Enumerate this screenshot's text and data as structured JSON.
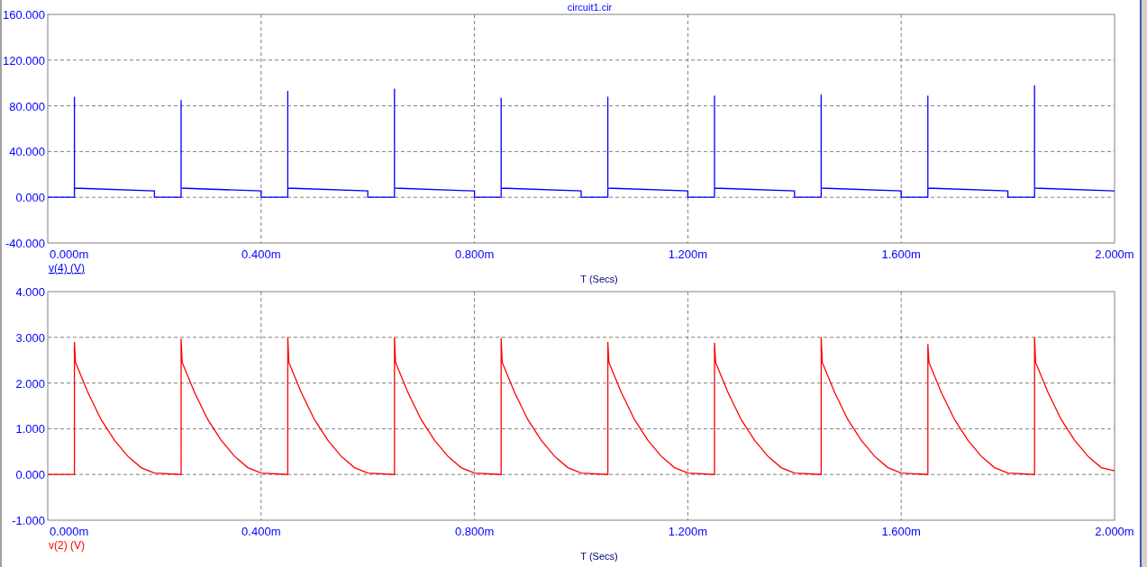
{
  "window": {
    "title": "circuit1.cir"
  },
  "plots": [
    {
      "chart_data": {
        "type": "line",
        "grid": true,
        "xlabel": "T (Secs)",
        "xlim": [
          0,
          2
        ],
        "ylim": [
          -40,
          160
        ],
        "xticks": [
          {
            "value": 0,
            "label": "0.000m"
          },
          {
            "value": 0.4,
            "label": "0.400m"
          },
          {
            "value": 0.8,
            "label": "0.800m"
          },
          {
            "value": 1.2,
            "label": "1.200m"
          },
          {
            "value": 1.6,
            "label": "1.600m"
          },
          {
            "value": 2,
            "label": "2.000m"
          }
        ],
        "yticks": [
          {
            "value": -40,
            "label": "-40.000"
          },
          {
            "value": 0,
            "label": "0.000"
          },
          {
            "value": 40,
            "label": "40.000"
          },
          {
            "value": 80,
            "label": "80.000"
          },
          {
            "value": 120,
            "label": "120.000"
          },
          {
            "value": 160,
            "label": "160.000"
          }
        ],
        "x": [
          0,
          0.05,
          0.05,
          0.05,
          0.2,
          0.2,
          0.25,
          0.25,
          0.25,
          0.4,
          0.4,
          0.45,
          0.45,
          0.45,
          0.6,
          0.6,
          0.65,
          0.65,
          0.65,
          0.8,
          0.8,
          0.85,
          0.85,
          0.85,
          1.0,
          1.0,
          1.05,
          1.05,
          1.05,
          1.2,
          1.2,
          1.25,
          1.25,
          1.25,
          1.4,
          1.4,
          1.45,
          1.45,
          1.45,
          1.6,
          1.6,
          1.65,
          1.65,
          1.65,
          1.8,
          1.8,
          1.85,
          1.85,
          1.85,
          2.0
        ],
        "series": [
          {
            "name": "v(4) (V)",
            "color": "#0000ff",
            "values": [
              0,
              0,
              88,
              8,
              5.5,
              0,
              0,
              85,
              8,
              5.5,
              0,
              0,
              93,
              8,
              5.5,
              0,
              0,
              95,
              8,
              5.5,
              0,
              0,
              87,
              8,
              5.5,
              0,
              0,
              88,
              8,
              5.5,
              0,
              0,
              89,
              8,
              5.5,
              0,
              0,
              90,
              8,
              5.5,
              0,
              0,
              89,
              8,
              5.5,
              0,
              0,
              98,
              8,
              5.5
            ]
          }
        ]
      },
      "legend_underlined": true
    },
    {
      "chart_data": {
        "type": "line",
        "grid": true,
        "xlabel": "T (Secs)",
        "xlim": [
          0,
          2
        ],
        "ylim": [
          -1,
          4
        ],
        "xticks": [
          {
            "value": 0,
            "label": "0.000m"
          },
          {
            "value": 0.4,
            "label": "0.400m"
          },
          {
            "value": 0.8,
            "label": "0.800m"
          },
          {
            "value": 1.2,
            "label": "1.200m"
          },
          {
            "value": 1.6,
            "label": "1.600m"
          },
          {
            "value": 2,
            "label": "2.000m"
          }
        ],
        "yticks": [
          {
            "value": -1,
            "label": "-1.000"
          },
          {
            "value": 0,
            "label": "0.000"
          },
          {
            "value": 1,
            "label": "1.000"
          },
          {
            "value": 2,
            "label": "2.000"
          },
          {
            "value": 3,
            "label": "3.000"
          },
          {
            "value": 4,
            "label": "4.000"
          }
        ],
        "x": [
          0,
          0.05,
          0.05,
          0.052,
          0.075,
          0.1,
          0.125,
          0.15,
          0.175,
          0.2,
          0.25,
          0.25,
          0.252,
          0.275,
          0.3,
          0.325,
          0.35,
          0.375,
          0.4,
          0.45,
          0.45,
          0.452,
          0.475,
          0.5,
          0.525,
          0.55,
          0.575,
          0.6,
          0.65,
          0.65,
          0.652,
          0.675,
          0.7,
          0.725,
          0.75,
          0.775,
          0.8,
          0.85,
          0.85,
          0.852,
          0.875,
          0.9,
          0.925,
          0.95,
          0.975,
          1.0,
          1.05,
          1.05,
          1.052,
          1.075,
          1.1,
          1.125,
          1.15,
          1.175,
          1.2,
          1.25,
          1.25,
          1.252,
          1.275,
          1.3,
          1.325,
          1.35,
          1.375,
          1.4,
          1.45,
          1.45,
          1.452,
          1.475,
          1.5,
          1.525,
          1.55,
          1.575,
          1.6,
          1.65,
          1.65,
          1.652,
          1.675,
          1.7,
          1.725,
          1.75,
          1.775,
          1.8,
          1.85,
          1.85,
          1.852,
          1.875,
          1.9,
          1.925,
          1.95,
          1.975,
          2.0
        ],
        "series": [
          {
            "name": "v(2) (V)",
            "color": "#ff0000",
            "values": [
              0,
              0,
              2.9,
              2.45,
              1.8,
              1.2,
              0.75,
              0.4,
              0.15,
              0.03,
              0,
              2.97,
              2.45,
              1.8,
              1.2,
              0.75,
              0.4,
              0.15,
              0.03,
              0,
              3.0,
              2.45,
              1.8,
              1.2,
              0.75,
              0.4,
              0.15,
              0.03,
              0,
              3.0,
              2.45,
              1.8,
              1.2,
              0.75,
              0.4,
              0.15,
              0.03,
              0,
              2.98,
              2.45,
              1.8,
              1.2,
              0.75,
              0.4,
              0.15,
              0.03,
              0,
              2.9,
              2.45,
              1.8,
              1.2,
              0.75,
              0.4,
              0.15,
              0.03,
              0,
              2.88,
              2.45,
              1.8,
              1.2,
              0.75,
              0.4,
              0.15,
              0.03,
              0,
              3.0,
              2.45,
              1.8,
              1.2,
              0.75,
              0.4,
              0.15,
              0.03,
              0,
              2.85,
              2.45,
              1.8,
              1.2,
              0.75,
              0.4,
              0.15,
              0.03,
              0,
              3.0,
              2.45,
              1.8,
              1.2,
              0.75,
              0.4,
              0.15,
              0.08
            ]
          }
        ]
      },
      "legend_underlined": false
    }
  ]
}
